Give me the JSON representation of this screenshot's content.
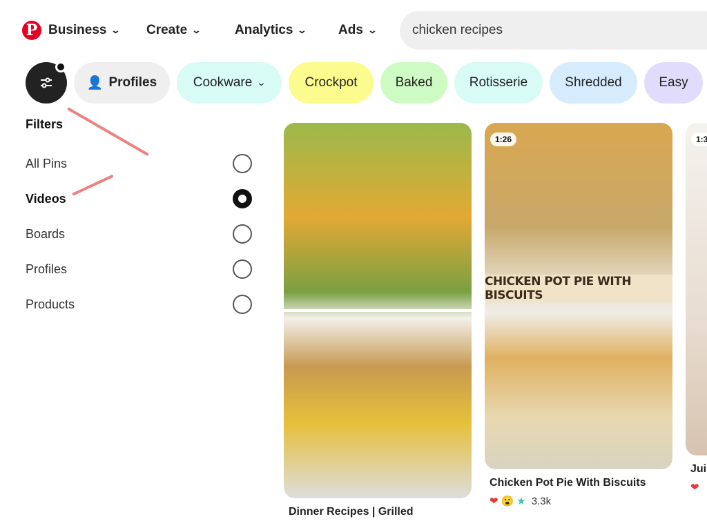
{
  "nav": {
    "items": [
      {
        "label": "Business"
      },
      {
        "label": "Create"
      },
      {
        "label": "Analytics"
      },
      {
        "label": "Ads"
      }
    ],
    "search_value": "chicken recipes"
  },
  "chips": [
    {
      "label": "Profiles",
      "color": "#efefef"
    },
    {
      "label": "Cookware",
      "color": "#d8fbf6"
    },
    {
      "label": "Crockpot",
      "color": "#fcfc8e"
    },
    {
      "label": "Baked",
      "color": "#cdfbc3"
    },
    {
      "label": "Rotisserie",
      "color": "#d8fbf6"
    },
    {
      "label": "Shredded",
      "color": "#d6ecfd"
    },
    {
      "label": "Easy",
      "color": "#e2dcfc"
    }
  ],
  "filters": {
    "title": "Filters",
    "options": [
      {
        "label": "All Pins",
        "selected": false
      },
      {
        "label": "Videos",
        "selected": true
      },
      {
        "label": "Boards",
        "selected": false
      },
      {
        "label": "Profiles",
        "selected": false
      },
      {
        "label": "Products",
        "selected": false
      }
    ]
  },
  "pins": [
    {
      "title": "Dinner Recipes | Grilled"
    },
    {
      "title": "Chicken Pot Pie With Biscuits",
      "duration": "1:26",
      "overlay_text": "CHICKEN POT PIE WITH BISCUITS",
      "reactions": "3.3k"
    },
    {
      "title": "Jui",
      "duration": "1:3"
    }
  ]
}
